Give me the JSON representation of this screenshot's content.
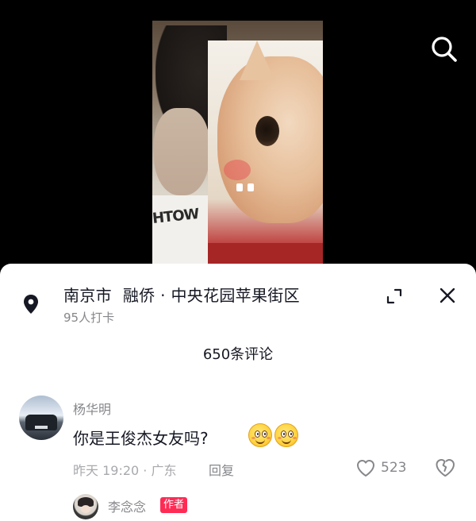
{
  "video": {
    "shirt_text": "HTOW"
  },
  "location": {
    "city": "南京市",
    "place": "融侨 · 中央花园苹果街区",
    "checkins": "95人打卡"
  },
  "comments_header": {
    "count_label": "650条评论"
  },
  "comment": {
    "username": "杨华明",
    "text": "你是王俊杰女友吗?",
    "time_location": "昨天 19:20 · 广东",
    "reply_label": "回复",
    "like_count": "523"
  },
  "reply_preview": {
    "username": "李念念",
    "badge": "作者"
  },
  "icons": {
    "search": "search-icon",
    "location": "location-pin-icon",
    "expand": "expand-icon",
    "close": "close-icon",
    "like": "heart-icon",
    "dislike": "broken-heart-icon",
    "emoji": "smiling-face-emoji"
  },
  "colors": {
    "accent": "#fe2c55",
    "text_primary": "#161823",
    "text_secondary": "#86878b"
  }
}
